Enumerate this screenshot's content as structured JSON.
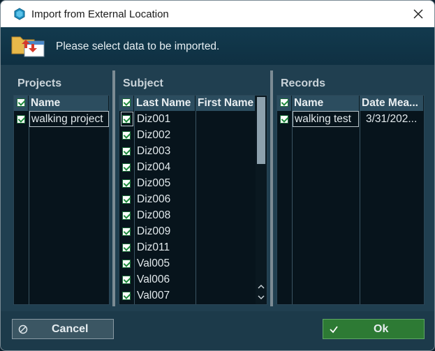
{
  "window": {
    "title": "Import from External Location"
  },
  "header": {
    "message": "Please select data to be imported."
  },
  "projects": {
    "title": "Projects",
    "columns": [
      "Name"
    ],
    "rows": [
      {
        "name": "walking project",
        "checked": true
      }
    ]
  },
  "subject": {
    "title": "Subject",
    "columns": [
      "Last Name",
      "First Name"
    ],
    "rows": [
      {
        "last": "Diz001",
        "first": "",
        "checked": true
      },
      {
        "last": "Diz002",
        "first": "",
        "checked": true
      },
      {
        "last": "Diz003",
        "first": "",
        "checked": true
      },
      {
        "last": "Diz004",
        "first": "",
        "checked": true
      },
      {
        "last": "Diz005",
        "first": "",
        "checked": true
      },
      {
        "last": "Diz006",
        "first": "",
        "checked": true
      },
      {
        "last": "Diz008",
        "first": "",
        "checked": true
      },
      {
        "last": "Diz009",
        "first": "",
        "checked": true
      },
      {
        "last": "Diz011",
        "first": "",
        "checked": true
      },
      {
        "last": "Val005",
        "first": "",
        "checked": true
      },
      {
        "last": "Val006",
        "first": "",
        "checked": true
      },
      {
        "last": "Val007",
        "first": "",
        "checked": true
      }
    ]
  },
  "records": {
    "title": "Records",
    "columns": [
      "Name",
      "Date Mea..."
    ],
    "rows": [
      {
        "name": "walking test",
        "date": "3/31/202...",
        "checked": true
      }
    ]
  },
  "buttons": {
    "cancel": "Cancel",
    "ok": "Ok"
  },
  "colors": {
    "accent_ok": "#2d7a34",
    "background": "#203f50"
  },
  "icons": {
    "app": "app-logo-icon",
    "close": "close-icon",
    "header": "import-folder-icon",
    "cancel": "cancel-circle-icon",
    "ok": "check-icon"
  }
}
